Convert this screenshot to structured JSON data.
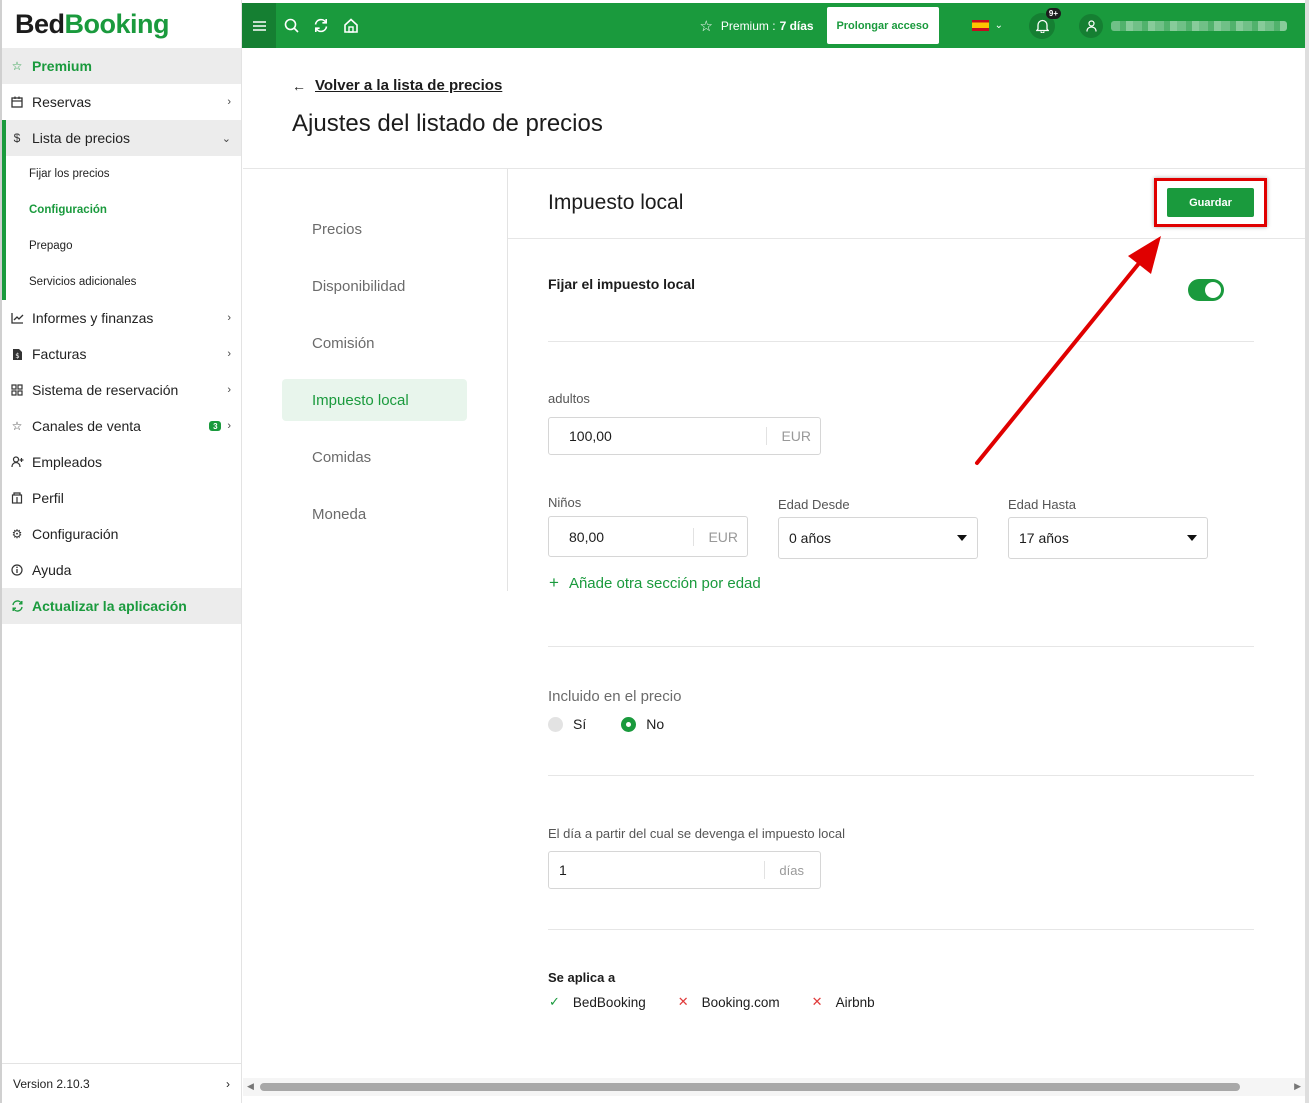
{
  "brand": {
    "part1": "Bed",
    "part2": "Booking"
  },
  "sidebar": {
    "premium": "Premium",
    "reservas": "Reservas",
    "lista_precios": "Lista de precios",
    "sub": {
      "fijar": "Fijar los precios",
      "configuracion": "Configuración",
      "prepago": "Prepago",
      "servicios": "Servicios adicionales"
    },
    "informes": "Informes y finanzas",
    "facturas": "Facturas",
    "sistema": "Sistema de reservación",
    "canales": "Canales de venta",
    "canales_badge": "3",
    "empleados": "Empleados",
    "perfil": "Perfil",
    "configuracion": "Configuración",
    "ayuda": "Ayuda",
    "actualizar": "Actualizar la aplicación",
    "version": "Version 2.10.3"
  },
  "topbar": {
    "premium_label": "Premium :",
    "premium_days": "7 días",
    "prolong": "Prolongar acceso",
    "notifications": "9+"
  },
  "header": {
    "back": "Volver a la lista de precios",
    "title": "Ajustes del listado de precios"
  },
  "tabs": [
    "Precios",
    "Disponibilidad",
    "Comisión",
    "Impuesto local",
    "Comidas",
    "Moneda"
  ],
  "section": {
    "title": "Impuesto local",
    "save": "Guardar",
    "toggle_label": "Fijar el impuesto local",
    "toggle_on": true,
    "adults_label": "adultos",
    "adults_value": "100,00",
    "currency": "EUR",
    "kids_label": "Niños",
    "kids_value": "80,00",
    "age_from_label": "Edad Desde",
    "age_from_value": "0 años",
    "age_to_label": "Edad Hasta",
    "age_to_value": "17 años",
    "add_age": "Añade otra sección por edad",
    "included_label": "Incluido en el precio",
    "opt_yes": "Sí",
    "opt_no": "No",
    "day_label": "El día a partir del cual se devenga el impuesto local",
    "day_value": "1",
    "day_unit": "días",
    "applies_label": "Se aplica a",
    "applies": [
      {
        "name": "BedBooking",
        "enabled": true
      },
      {
        "name": "Booking.com",
        "enabled": false
      },
      {
        "name": "Airbnb",
        "enabled": false
      }
    ]
  },
  "colors": {
    "brand": "#1a9a3d",
    "annotation": "#e00000"
  }
}
